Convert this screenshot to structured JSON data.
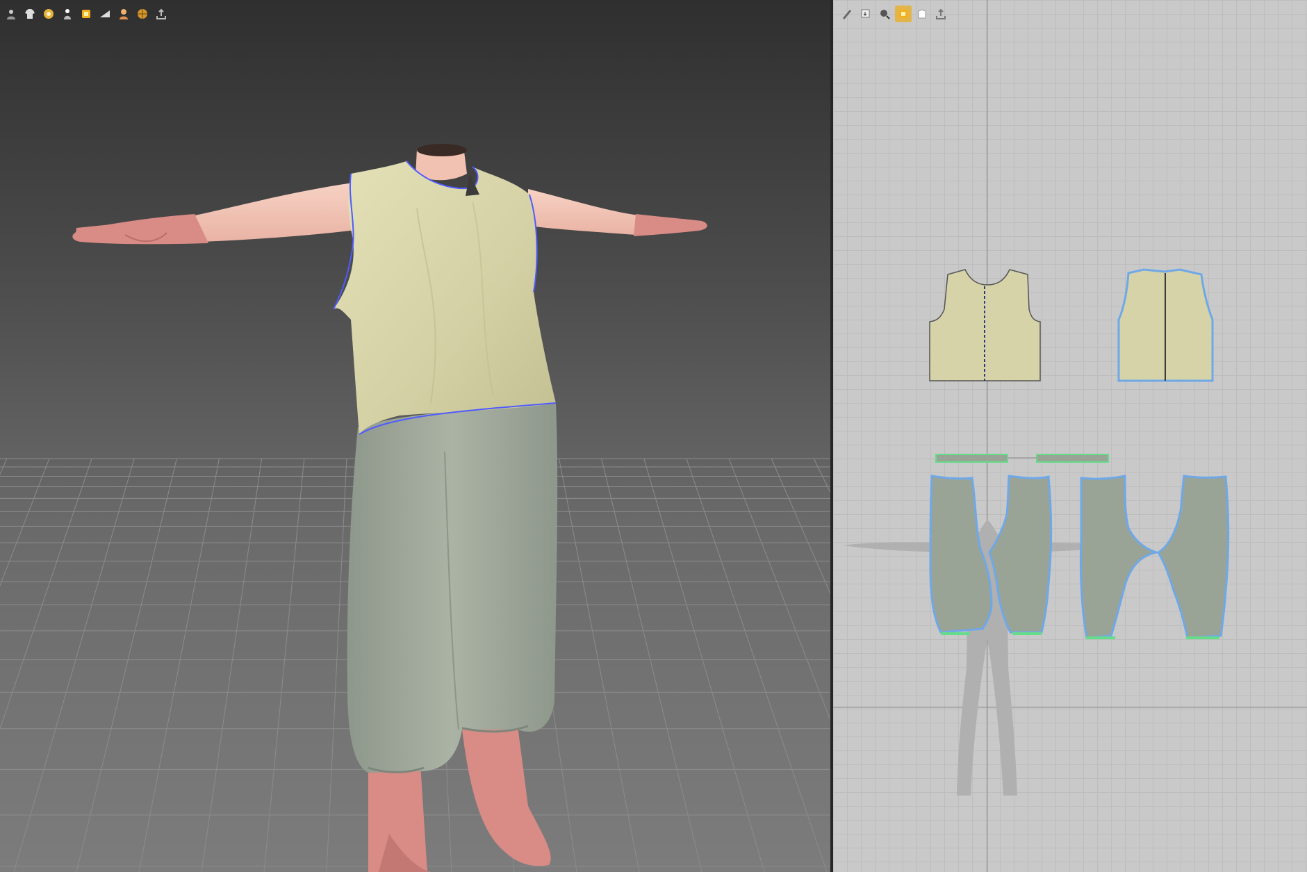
{
  "viewport_3d": {
    "toolbar_icons": [
      "avatar-display-icon",
      "garment-display-icon",
      "simulation-icon",
      "avatar-visibility-icon",
      "texture-mode-icon",
      "fabric-surface-icon",
      "skin-tone-icon",
      "texture-world-icon",
      "export-icon"
    ]
  },
  "viewport_2d": {
    "toolbar_icons": [
      "edit-pattern-icon",
      "transform-pattern-icon",
      "zoom-pattern-icon",
      "texture-display-icon",
      "pattern-display-icon",
      "export-pattern-icon"
    ],
    "active_tool": "texture-display-icon"
  },
  "colors": {
    "top_fabric": "#d6d3a8",
    "pants_fabric": "#9aa496",
    "skin": "#f3c3b4",
    "skin_shade": "#d98b86",
    "seam_line": "#4f5bff",
    "pattern_outline_blue": "#6fa8e8",
    "elastic_green": "#66dd88"
  }
}
